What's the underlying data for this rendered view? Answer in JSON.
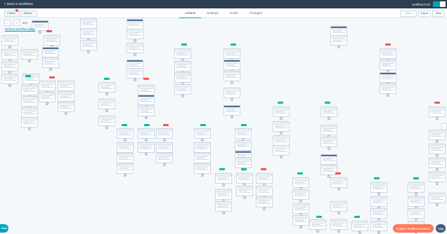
{
  "topbar": {
    "back_label": "Back to workflows",
    "workflow_name": "workflow 5.04"
  },
  "subbar": {
    "menu_label": "Menu",
    "search_label": "Search",
    "undo_label": "Undo",
    "export_label": "Export",
    "more_label": "More",
    "tabs": [
      {
        "label": "Actions",
        "active": true
      },
      {
        "label": "Settings",
        "active": false
      },
      {
        "label": "Goals",
        "active": false
      },
      {
        "label": "Changes",
        "active": false
      }
    ]
  },
  "canvas": {
    "zoom_minus": "–",
    "zoom_plus": "+",
    "zoom_level": "50%",
    "review_link": "Review workflow alerts"
  },
  "bottom": {
    "beta_label": "Beta",
    "explore_label": "Explore workflow features",
    "help_label": "Help"
  },
  "colors": {
    "topbar": "#2d3e50",
    "accent": "#00a4bd",
    "teal": "#00bda5",
    "red": "#f2545b",
    "orange": "#ff7a59"
  }
}
